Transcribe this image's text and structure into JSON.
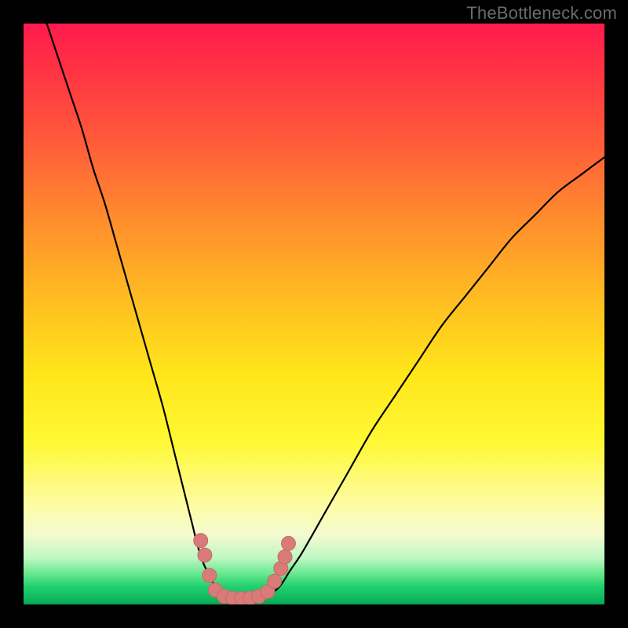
{
  "watermark": "TheBottleneck.com",
  "colors": {
    "frame": "#000000",
    "curve_stroke": "#000000",
    "marker_fill": "#d97b78",
    "marker_stroke": "#c86a67"
  },
  "chart_data": {
    "type": "line",
    "title": "",
    "xlabel": "",
    "ylabel": "",
    "xlim": [
      0,
      100
    ],
    "ylim": [
      0,
      100
    ],
    "gradient_stops": [
      {
        "pct": 0,
        "color": "#ff1a4d"
      },
      {
        "pct": 8,
        "color": "#ff3344"
      },
      {
        "pct": 20,
        "color": "#ff5a3a"
      },
      {
        "pct": 33,
        "color": "#ff8a2e"
      },
      {
        "pct": 46,
        "color": "#ffb822"
      },
      {
        "pct": 60,
        "color": "#ffe51a"
      },
      {
        "pct": 72,
        "color": "#fff833"
      },
      {
        "pct": 83,
        "color": "#fdfca6"
      },
      {
        "pct": 88,
        "color": "#f4fad0"
      },
      {
        "pct": 92,
        "color": "#bff7c3"
      },
      {
        "pct": 95,
        "color": "#5ee68a"
      },
      {
        "pct": 97,
        "color": "#1fcf6e"
      },
      {
        "pct": 99,
        "color": "#0fb85e"
      },
      {
        "pct": 100,
        "color": "#0aa454"
      }
    ],
    "series": [
      {
        "name": "curve-left",
        "x": [
          4,
          6,
          8,
          10,
          12,
          14,
          16,
          18,
          20,
          22,
          24,
          26,
          27,
          28,
          29,
          30,
          31,
          32,
          33,
          34
        ],
        "y": [
          100,
          94,
          88,
          82,
          75,
          69,
          62,
          55,
          48,
          41,
          34,
          26,
          22,
          18,
          14,
          10,
          7,
          5,
          3,
          1.5
        ]
      },
      {
        "name": "curve-floor",
        "x": [
          34,
          36,
          38,
          40,
          42
        ],
        "y": [
          1.5,
          1.0,
          0.8,
          1.0,
          1.6
        ]
      },
      {
        "name": "curve-right",
        "x": [
          42,
          44,
          46,
          48,
          52,
          56,
          60,
          64,
          68,
          72,
          76,
          80,
          84,
          88,
          92,
          96,
          100
        ],
        "y": [
          1.6,
          3,
          6,
          9,
          16,
          23,
          30,
          36,
          42,
          48,
          53,
          58,
          63,
          67,
          71,
          74,
          77
        ]
      }
    ],
    "markers": {
      "name": "highlight-markers",
      "points": [
        {
          "x": 30.5,
          "y": 11.0
        },
        {
          "x": 31.2,
          "y": 8.5
        },
        {
          "x": 32.0,
          "y": 5.0
        },
        {
          "x": 33.0,
          "y": 2.5
        },
        {
          "x": 34.5,
          "y": 1.4
        },
        {
          "x": 36.0,
          "y": 1.1
        },
        {
          "x": 37.5,
          "y": 1.0
        },
        {
          "x": 39.0,
          "y": 1.1
        },
        {
          "x": 40.5,
          "y": 1.4
        },
        {
          "x": 42.0,
          "y": 2.2
        },
        {
          "x": 43.2,
          "y": 4.0
        },
        {
          "x": 44.3,
          "y": 6.2
        },
        {
          "x": 45.0,
          "y": 8.2
        },
        {
          "x": 45.6,
          "y": 10.5
        }
      ]
    }
  }
}
